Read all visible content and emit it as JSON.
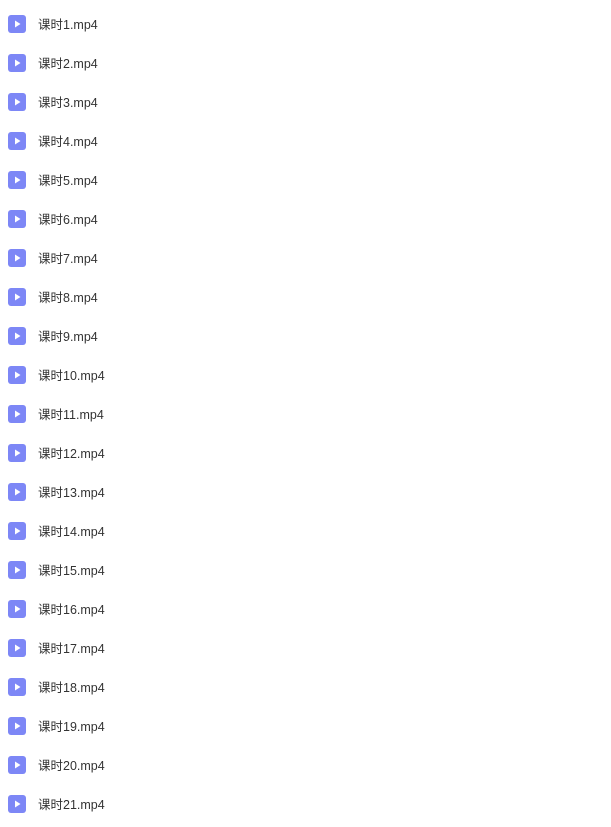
{
  "files": [
    {
      "name": "课时1.mp4"
    },
    {
      "name": "课时2.mp4"
    },
    {
      "name": "课时3.mp4"
    },
    {
      "name": "课时4.mp4"
    },
    {
      "name": "课时5.mp4"
    },
    {
      "name": "课时6.mp4"
    },
    {
      "name": "课时7.mp4"
    },
    {
      "name": "课时8.mp4"
    },
    {
      "name": "课时9.mp4"
    },
    {
      "name": "课时10.mp4"
    },
    {
      "name": "课时11.mp4"
    },
    {
      "name": "课时12.mp4"
    },
    {
      "name": "课时13.mp4"
    },
    {
      "name": "课时14.mp4"
    },
    {
      "name": "课时15.mp4"
    },
    {
      "name": "课时16.mp4"
    },
    {
      "name": "课时17.mp4"
    },
    {
      "name": "课时18.mp4"
    },
    {
      "name": "课时19.mp4"
    },
    {
      "name": "课时20.mp4"
    },
    {
      "name": "课时21.mp4"
    }
  ]
}
